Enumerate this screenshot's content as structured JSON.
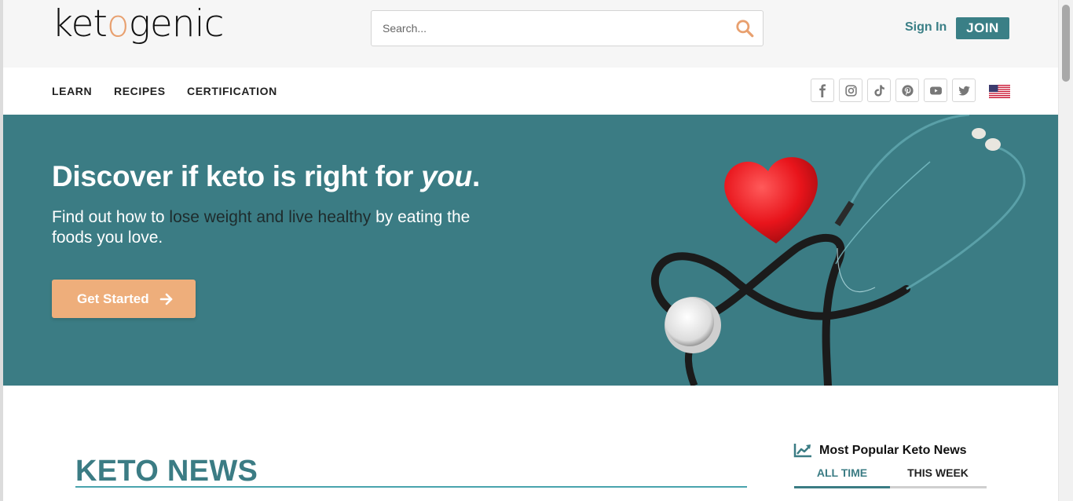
{
  "header": {
    "logo_text": {
      "pre": "ket",
      "drop": "o",
      "post": "genic"
    },
    "search": {
      "placeholder": "Search..."
    },
    "sign_in_label": "Sign In",
    "join_label": "JOIN"
  },
  "nav": {
    "items": [
      "LEARN",
      "RECIPES",
      "CERTIFICATION"
    ],
    "social_icons": [
      "facebook-icon",
      "instagram-icon",
      "tiktok-icon",
      "pinterest-icon",
      "youtube-icon",
      "twitter-icon"
    ],
    "flag": "us-flag-icon"
  },
  "hero": {
    "title_main": "Discover if keto is right for ",
    "title_em": "you",
    "title_end": ".",
    "subtitle_pre": "Find out how to ",
    "subtitle_highlight": "lose weight and live healthy",
    "subtitle_post": " by eating the foods you love.",
    "cta_label": "Get Started"
  },
  "news": {
    "title": "KETO NEWS"
  },
  "popular": {
    "title": "Most Popular Keto News",
    "tabs": [
      "ALL TIME",
      "THIS WEEK"
    ],
    "active_tab": "ALL TIME"
  },
  "colors": {
    "brand_teal": "#3b7c84",
    "accent_orange": "#eeae7b",
    "header_bg": "#f6f6f6"
  }
}
